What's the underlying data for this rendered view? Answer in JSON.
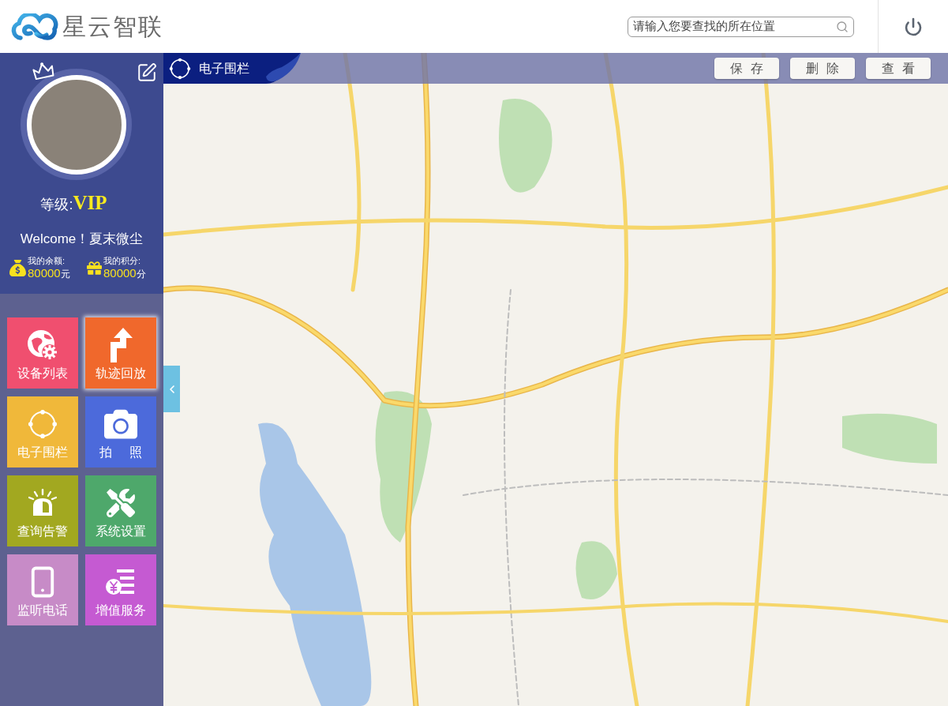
{
  "header": {
    "logo_text": "星云智联",
    "search": {
      "placeholder": "请输入您要查找的所在位置"
    }
  },
  "profile": {
    "level_label": "等级:",
    "level_value": "VIP",
    "welcome": "Welcome！夏末微尘",
    "balance": {
      "label": "我的余额:",
      "amount": "80000",
      "unit": "元"
    },
    "points": {
      "label": "我的积分:",
      "amount": "80000",
      "unit": "分"
    }
  },
  "tiles": [
    {
      "kind": "device",
      "label": "设备列表",
      "color": "#f04f6f",
      "selected": false
    },
    {
      "kind": "track",
      "label": "轨迹回放",
      "color": "#f0682c",
      "selected": true
    },
    {
      "kind": "fence",
      "label": "电子围栏",
      "color": "#f0b83a",
      "selected": false
    },
    {
      "kind": "camera",
      "label": "拍 照",
      "color": "#4c6adb",
      "selected": false
    },
    {
      "kind": "alarm",
      "label": "查询告警",
      "color": "#a2a820",
      "selected": false
    },
    {
      "kind": "tools",
      "label": "系统设置",
      "color": "#4ea86b",
      "selected": false
    },
    {
      "kind": "phone",
      "label": "监听电话",
      "color": "#c78bc7",
      "selected": false
    },
    {
      "kind": "service",
      "label": "增值服务",
      "color": "#c55ad2",
      "selected": false
    }
  ],
  "map_toolbar": {
    "title": "电子围栏",
    "buttons": [
      "保 存",
      "删 除",
      "查 看"
    ]
  }
}
